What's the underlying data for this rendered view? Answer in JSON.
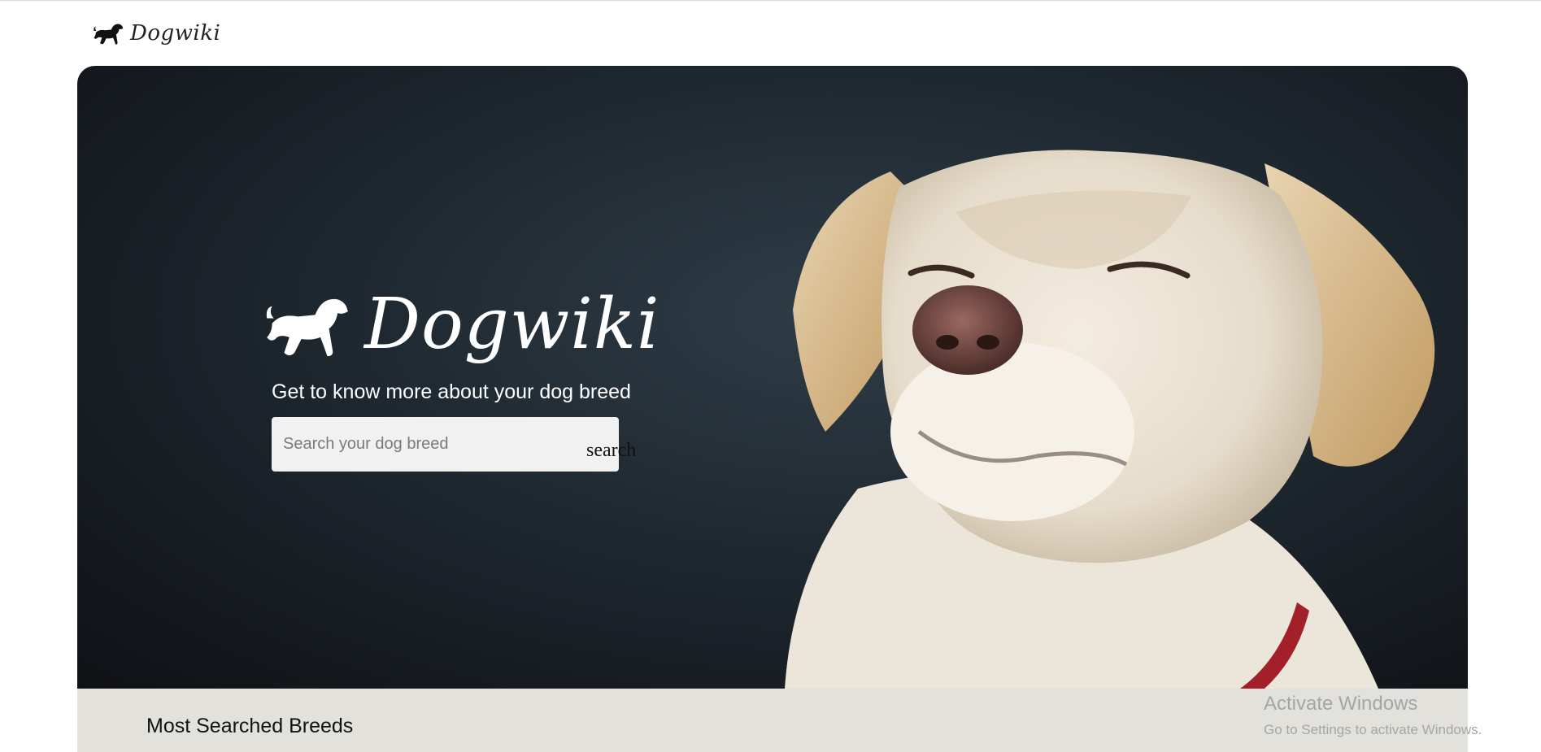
{
  "header": {
    "logo_text": "Dogwiki"
  },
  "hero": {
    "brand_text": "Dogwiki",
    "tagline": "Get to know more about your dog breed",
    "search": {
      "placeholder": "Search your dog breed",
      "value": "",
      "button_label": "search"
    }
  },
  "breeds": {
    "title": "Most Searched Breeds"
  },
  "watermark": {
    "title": "Activate Windows",
    "subtitle": "Go to Settings to activate Windows."
  },
  "colors": {
    "hero_dark": "#1f2830",
    "dog_fur": "#efe6d6",
    "dog_ear": "#d7b98a",
    "dog_nose": "#7a4e48",
    "collar": "#a3202a",
    "breeds_bg": "#e2e1dc"
  }
}
